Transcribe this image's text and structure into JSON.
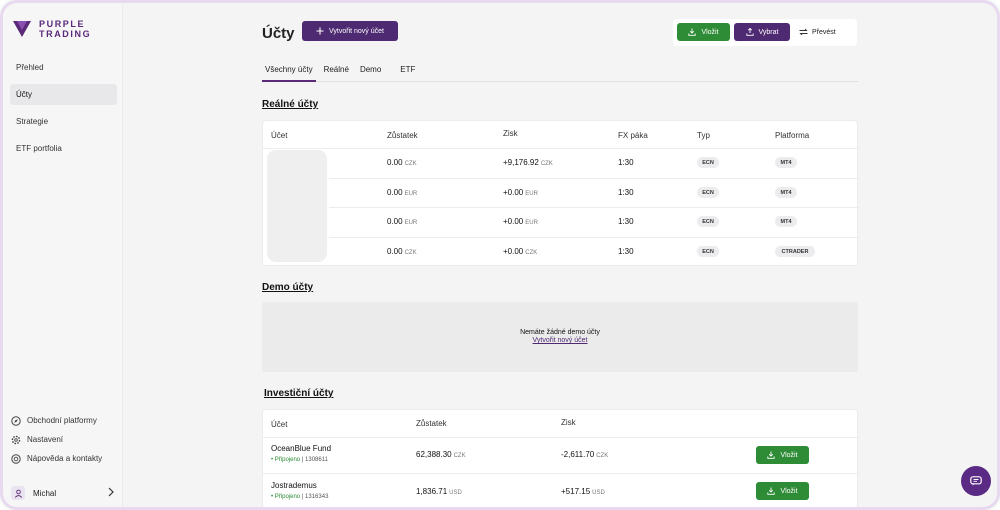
{
  "brand": {
    "line1": "PURPLE",
    "line2": "TRADING"
  },
  "sidebar": {
    "items": [
      {
        "label": "Přehled"
      },
      {
        "label": "Účty"
      },
      {
        "label": "Strategie"
      },
      {
        "label": "ETF portfolia"
      }
    ],
    "bottom": [
      {
        "label": "Obchodní platformy",
        "icon": "compass-icon"
      },
      {
        "label": "Nastavení",
        "icon": "gear-icon"
      },
      {
        "label": "Nápověda a kontakty",
        "icon": "help-icon"
      }
    ],
    "user": {
      "name": "Michal"
    }
  },
  "header": {
    "title": "Účty",
    "new_account": "Vytvořit nový účet",
    "deposit": "Vložit",
    "withdraw": "Vybrat",
    "transfer": "Převést"
  },
  "tabs": [
    {
      "label": "Všechny účty"
    },
    {
      "label": "Reálné"
    },
    {
      "label": "Demo"
    },
    {
      "label": "ETF"
    }
  ],
  "real": {
    "title": "Reálné účty",
    "columns": [
      "Účet",
      "Zůstatek",
      "Zisk",
      "FX páka",
      "Typ",
      "Platforma"
    ],
    "rows": [
      {
        "balance": "0.00",
        "balance_cur": "CZK",
        "profit": "+9,176.92",
        "profit_cur": "CZK",
        "leverage": "1:30",
        "type": "ECN",
        "platform": "MT4"
      },
      {
        "balance": "0.00",
        "balance_cur": "EUR",
        "profit": "+0.00",
        "profit_cur": "EUR",
        "leverage": "1:30",
        "type": "ECN",
        "platform": "MT4"
      },
      {
        "balance": "0.00",
        "balance_cur": "EUR",
        "profit": "+0.00",
        "profit_cur": "EUR",
        "leverage": "1:30",
        "type": "ECN",
        "platform": "MT4"
      },
      {
        "balance": "0.00",
        "balance_cur": "CZK",
        "profit": "+0.00",
        "profit_cur": "CZK",
        "leverage": "1:30",
        "type": "ECN",
        "platform": "CTRADER"
      }
    ]
  },
  "demo": {
    "title": "Demo účty",
    "empty": "Nemáte žádné demo účty",
    "create": "Vytvořit nový účet"
  },
  "investment": {
    "title": "Investiční účty",
    "columns": [
      "Účet",
      "Zůstatek",
      "Zisk"
    ],
    "rows": [
      {
        "name": "OceanBlue Fund",
        "status": "Připojeno",
        "id": "1308611",
        "balance": "62,388.30",
        "balance_cur": "CZK",
        "profit": "-2,611.70",
        "profit_cur": "CZK",
        "action": "Vložit"
      },
      {
        "name": "Jostrademus",
        "status": "Připojeno",
        "id": "1316343",
        "balance": "1,836.71",
        "balance_cur": "USD",
        "profit": "+517.15",
        "profit_cur": "USD",
        "action": "Vložit"
      }
    ]
  },
  "colors": {
    "brand": "#4e2a72",
    "green": "#2e8b36"
  }
}
